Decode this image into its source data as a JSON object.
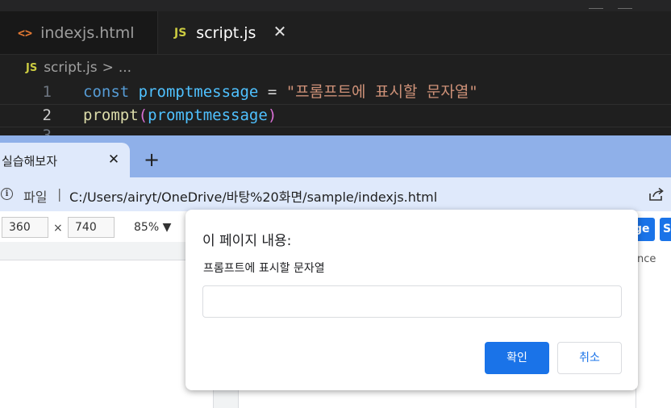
{
  "editor": {
    "tabs": [
      {
        "label": "indexjs.html",
        "icon": "html-icon",
        "active": false
      },
      {
        "label": "script.js",
        "icon": "js-icon",
        "active": true
      }
    ],
    "close_glyph": "✕",
    "breadcrumb": {
      "file": "script.js",
      "separator": ">",
      "more": "..."
    },
    "icons": {
      "html": "<>",
      "js": "JS"
    },
    "lines": [
      {
        "number": "1",
        "keyword": "const",
        "variable": "promptmessage",
        "operator": " = ",
        "string": "\"프롬프트에 표시할 문자열\""
      },
      {
        "number": "2",
        "function": "prompt",
        "open_paren": "(",
        "argument": "promptmessage",
        "close_paren": ")"
      }
    ],
    "partial_line_number": "3"
  },
  "browser": {
    "tab_title": "실습해보자",
    "tab_close": "✕",
    "new_tab": "+",
    "address": {
      "scheme_label": "파일",
      "divider": "|",
      "url": "C:/Users/airyt/OneDrive/바탕%20화면/sample/indexjs.html"
    },
    "devtools": {
      "width": "360",
      "height": "740",
      "times": "×",
      "zoom": "85% ▼",
      "right_button_1": "ge",
      "right_button_2": "S",
      "right_label": "nce"
    }
  },
  "dialog": {
    "title": "이 페이지 내용:",
    "message": "프롬프트에 표시할 문자열",
    "input_value": "",
    "ok_label": "확인",
    "cancel_label": "취소"
  },
  "colors": {
    "accent": "#1a73e8",
    "editor_bg": "#1f1f1f",
    "chrome_tabstrip": "#8fb0e9"
  }
}
